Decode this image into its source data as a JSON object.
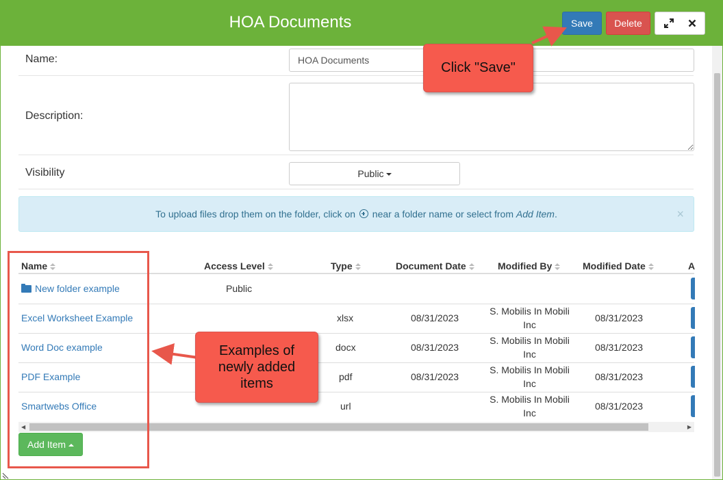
{
  "header": {
    "title": "HOA Documents",
    "save_label": "Save",
    "delete_label": "Delete",
    "expand_icon": "expand-icon",
    "close_icon": "close-icon"
  },
  "form": {
    "name_label": "Name:",
    "name_value": "HOA Documents",
    "description_label": "Description:",
    "description_value": "",
    "visibility_label": "Visibility",
    "visibility_value": "Public"
  },
  "info": {
    "text_before": "To upload files drop them on the folder, click on",
    "text_after": "near a folder name or select from",
    "emphasis": "Add Item",
    "period": ".",
    "close": "×"
  },
  "table": {
    "columns": [
      "Name",
      "Access Level",
      "Type",
      "Document Date",
      "Modified By",
      "Modified Date",
      "A"
    ],
    "rows": [
      {
        "name": "New folder example",
        "access": "Public",
        "type": "",
        "doc_date": "",
        "mod_by_1": "",
        "mod_by_2": "",
        "mod_date": "",
        "is_folder": true
      },
      {
        "name": "Excel Worksheet Example",
        "access": "",
        "type": "xlsx",
        "doc_date": "08/31/2023",
        "mod_by_1": "S. Mobilis In Mobili",
        "mod_by_2": "Inc",
        "mod_date": "08/31/2023"
      },
      {
        "name": "Word Doc example",
        "access": "",
        "type": "docx",
        "doc_date": "08/31/2023",
        "mod_by_1": "S. Mobilis In Mobili",
        "mod_by_2": "Inc",
        "mod_date": "08/31/2023"
      },
      {
        "name": "PDF Example",
        "access": "",
        "type": "pdf",
        "doc_date": "08/31/2023",
        "mod_by_1": "S. Mobilis In Mobili",
        "mod_by_2": "Inc",
        "mod_date": "08/31/2023"
      },
      {
        "name": "Smartwebs Office",
        "access": "",
        "type": "url",
        "doc_date": "",
        "mod_by_1": "S. Mobilis In Mobili",
        "mod_by_2": "Inc",
        "mod_date": "08/31/2023"
      }
    ]
  },
  "footer": {
    "add_item_label": "Add Item"
  },
  "annotations": {
    "save_callout": "Click \"Save\"",
    "items_callout_1": "Examples of",
    "items_callout_2": "newly added",
    "items_callout_3": "items"
  },
  "colors": {
    "header_green": "#6cb23a",
    "save_blue": "#337ab7",
    "delete_red": "#d9534f",
    "add_green": "#5cb85c",
    "callout_red": "#f65a4d",
    "info_bg": "#d9edf7"
  }
}
